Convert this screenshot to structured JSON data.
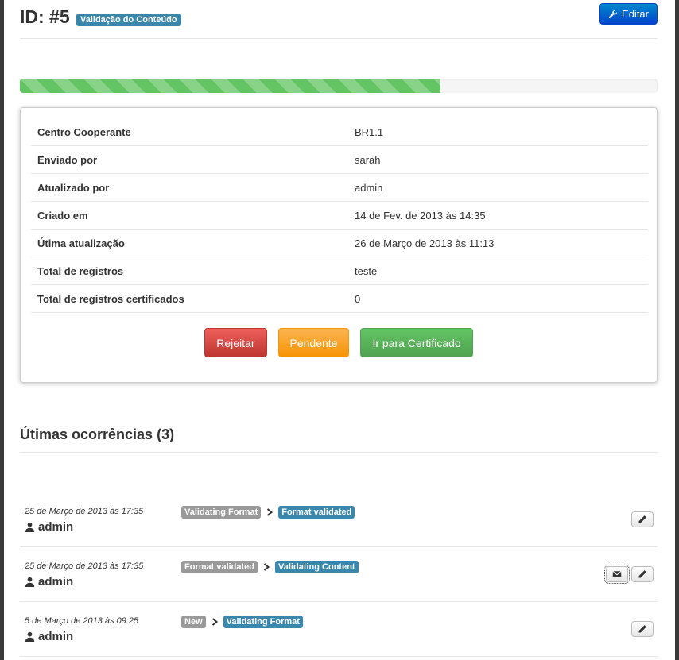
{
  "header": {
    "title": "ID: #5",
    "status_badge": "Validação do Conteúdo",
    "edit_label": "Editar"
  },
  "progress": {
    "percent": 66
  },
  "details": [
    {
      "key": "Centro Cooperante",
      "value": "BR1.1"
    },
    {
      "key": "Enviado por",
      "value": "sarah"
    },
    {
      "key": "Atualizado por",
      "value": "admin"
    },
    {
      "key": "Criado em",
      "value": "14 de Fev. de 2013 às 14:35"
    },
    {
      "key": "Útima atualização",
      "value": "26 de Março de 2013 às 11:13"
    },
    {
      "key": "Total de registros",
      "value": "teste"
    },
    {
      "key": "Total de registros certificados",
      "value": "0"
    }
  ],
  "actions": {
    "reject": "Rejeitar",
    "pending": "Pendente",
    "certify": "Ir para Certificado"
  },
  "occurrences": {
    "title": "Útimas ocorrências (3)",
    "items": [
      {
        "date": "25 de Março de 2013 às 17:35",
        "user": "admin",
        "from": "Validating Format",
        "to": "Format validated",
        "has_mail": false
      },
      {
        "date": "25 de Março de 2013 às 17:35",
        "user": "admin",
        "from": "Format validated",
        "to": "Validating Content",
        "has_mail": true
      },
      {
        "date": "5 de Março de 2013 às 09:25",
        "user": "admin",
        "from": "New",
        "to": "Validating Format",
        "has_mail": false
      }
    ]
  },
  "colors": {
    "primary": "#0088cc",
    "info": "#3a87ad",
    "danger": "#da4f49",
    "warning": "#faa732",
    "success": "#5bb75b",
    "muted_label": "#999999"
  },
  "icons": {
    "edit": "wrench-icon",
    "user": "user-icon",
    "arrow": "chevron-right-icon",
    "pencil": "pencil-icon",
    "mail": "envelope-icon"
  }
}
